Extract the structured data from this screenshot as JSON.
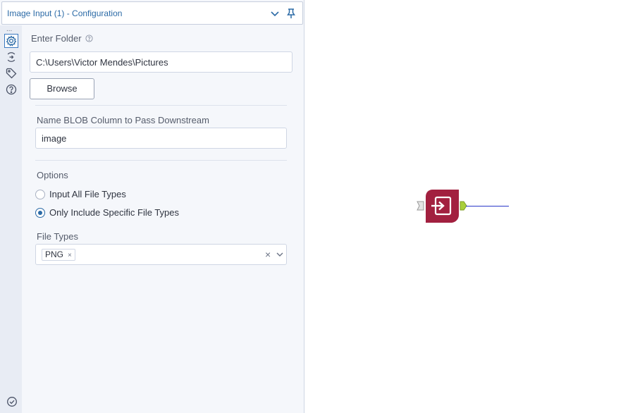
{
  "panel": {
    "title": "Image Input (1) - Configuration",
    "icons": [
      "chevron-down-icon",
      "pin-icon"
    ]
  },
  "sidebar": {
    "dots": "...",
    "items": [
      {
        "icon": "gear-icon",
        "active": true
      },
      {
        "icon": "connection-icon",
        "active": false
      },
      {
        "icon": "tag-icon",
        "active": false
      },
      {
        "icon": "help-circle-icon",
        "active": false
      }
    ],
    "status_icon": "check-circle-icon"
  },
  "folder": {
    "label": "Enter Folder",
    "value": "C:\\Users\\Victor Mendes\\Pictures",
    "browse_label": "Browse"
  },
  "blob": {
    "label": "Name BLOB Column to Pass Downstream",
    "value": "image"
  },
  "options": {
    "label": "Options",
    "radios": [
      {
        "label": "Input All File Types",
        "checked": false
      },
      {
        "label": "Only Include Specific File Types",
        "checked": true
      }
    ]
  },
  "file_types": {
    "label": "File Types",
    "selected": [
      "PNG"
    ],
    "chip_remove": "×",
    "clear": "×"
  },
  "canvas": {
    "tool_color": "#a2203f",
    "output_anchor_color": "#a9cf3b",
    "connection_color": "#2a37c9"
  }
}
